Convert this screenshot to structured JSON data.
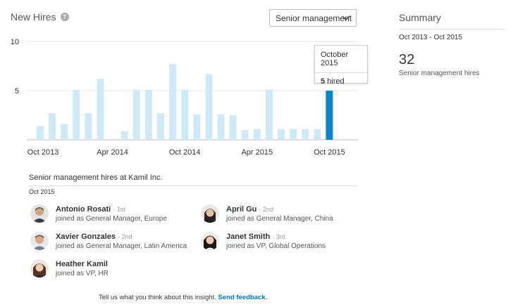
{
  "header": {
    "title": "New Hires",
    "help_icon": "question-circle-icon",
    "dropdown_value": "Senior management"
  },
  "colors": {
    "bar": "#cfe9f6",
    "bar_selected": "#0a84c6",
    "link": "#0077b5"
  },
  "chart_data": {
    "type": "bar",
    "categories": [
      "Oct 2013",
      "Nov 2013",
      "Dec 2013",
      "Jan 2014",
      "Feb 2014",
      "Mar 2014",
      "Apr 2014",
      "May 2014",
      "Jun 2014",
      "Jul 2014",
      "Aug 2014",
      "Sep 2014",
      "Oct 2014",
      "Nov 2014",
      "Dec 2014",
      "Jan 2015",
      "Feb 2015",
      "Mar 2015",
      "Apr 2015",
      "May 2015",
      "Jun 2015",
      "Jul 2015",
      "Aug 2015",
      "Sep 2015",
      "Oct 2015"
    ],
    "values": [
      1.4,
      2.7,
      1.6,
      5.1,
      2.7,
      6.2,
      0,
      0.9,
      5.1,
      5.1,
      2.7,
      7.7,
      5.1,
      2.6,
      6.7,
      2.6,
      2.5,
      1.0,
      1.1,
      5.1,
      1.1,
      1.1,
      1.1,
      1.1,
      5
    ],
    "selected_index": 24,
    "x_tick_labels": [
      "Oct 2013",
      "Apr 2014",
      "Oct 2014",
      "Apr 2015",
      "Oct 2015"
    ],
    "y_tick_labels": [
      "10",
      "5"
    ],
    "ylim": [
      0,
      10
    ]
  },
  "tooltip": {
    "title": "October 2015",
    "value": "5",
    "suffix": " hired"
  },
  "summary": {
    "title": "Summary",
    "range": "Oct 2013 - Oct 2015",
    "count": "32",
    "label": "Senior management hires"
  },
  "hires_section": {
    "title": "Senior management hires at Kamil Inc.",
    "month": "Oct 2015",
    "people": [
      {
        "name": "Antonio Rosati",
        "degree": "· 1st",
        "role": "joined as General Manager, Europe",
        "avatar": "avatar-antonio"
      },
      {
        "name": "April Gu",
        "degree": "· 2nd",
        "role": "joined as General Manager, China",
        "avatar": "avatar-april"
      },
      {
        "name": "Xavier Gonzales",
        "degree": "· 2nd",
        "role": "joined as General Manager, Latin America",
        "avatar": "avatar-xavier"
      },
      {
        "name": "Janet Smith",
        "degree": "· 3rd",
        "role": "joined as VP, Global Operations",
        "avatar": "avatar-janet"
      },
      {
        "name": "Heather Kamil",
        "degree": "",
        "role": "joined as VP, HR",
        "avatar": "avatar-heather"
      }
    ]
  },
  "footer": {
    "prompt": "Tell us what you think about this insight.",
    "link": "Send feedback."
  }
}
